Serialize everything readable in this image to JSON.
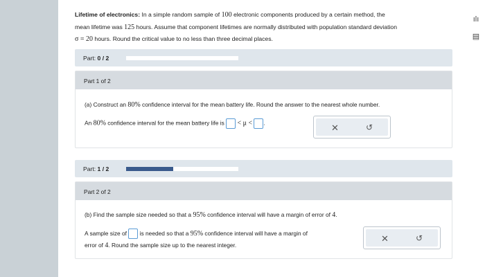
{
  "problem": {
    "title": "Lifetime of electronics:",
    "line1a": " In a simple random sample of ",
    "n": "100",
    "line1b": " electronic components produced by a certain method, the",
    "line2a": "mean lifetime was ",
    "mean": "125",
    "line2b": " hours. Assume that component lifetimes are normally distributed with population standard deviation",
    "sigma": "σ = 20",
    "line3": " hours. Round the critical value to no less than three decimal places."
  },
  "part_bar_1": {
    "label": "Part: ",
    "progress_text": "0 / 2",
    "progress": 0.0
  },
  "part_bar_2": {
    "label": "Part: ",
    "progress_text": "1 / 2",
    "progress": 0.42
  },
  "part1": {
    "header": "Part 1 of 2",
    "question_a": "(a) Construct an ",
    "question_pct": "80%",
    "question_b": " confidence interval for the mean battery life. Round the answer to the nearest whole number.",
    "answer_a": "An ",
    "answer_pct": "80%",
    "answer_b": " confidence interval for the mean battery life is ",
    "lt1": "< μ <",
    "period": "."
  },
  "part2": {
    "header": "Part 2 of 2",
    "question_a": "(b) Find the sample size needed so that a ",
    "question_pct": "95%",
    "question_b": " confidence interval will have a margin of error of ",
    "question_moe": "4",
    "question_c": ".",
    "answer_a": "A sample size of ",
    "answer_b": " is needed so that a ",
    "answer_pct": "95%",
    "answer_c": " confidence interval will have a margin of",
    "answer_d": "error of ",
    "answer_moe": "4",
    "answer_e": ". Round the sample size up to the nearest integer."
  },
  "buttons": {
    "clear": "✕",
    "undo": "↺"
  },
  "side_icons": {
    "top": "data-icon",
    "bottom": "calculator-icon",
    "top_glyph": "ılı",
    "bottom_glyph": "▤"
  }
}
